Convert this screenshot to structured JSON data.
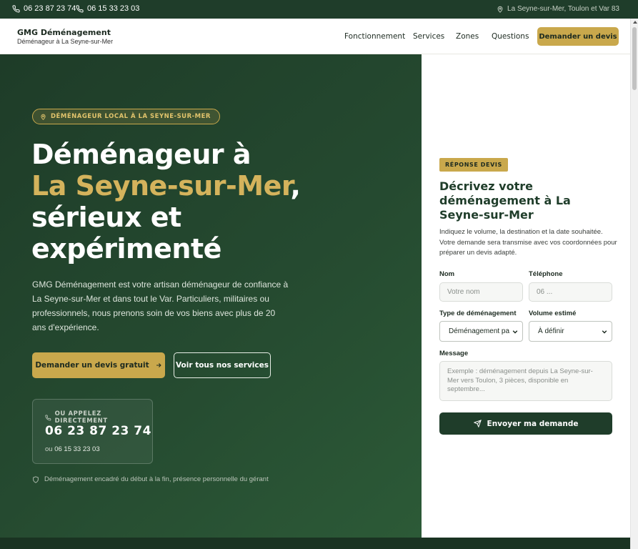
{
  "topbar": {
    "phone1": "06 23 87 23 74",
    "phone2": "06 15 33 23 03",
    "location": "La Seyne-sur-Mer, Toulon et Var 83"
  },
  "header": {
    "brand_title": "GMG Déménagement",
    "brand_subtitle": "Déménageur à La Seyne-sur-Mer",
    "nav": [
      "Fonctionnement",
      "Services",
      "Zones",
      "Questions"
    ],
    "cta": "Demander un devis"
  },
  "hero": {
    "badge": "DÉMÉNAGEUR LOCAL À LA SEYNE-SUR-MER",
    "title_line1": "Déménageur à",
    "title_highlight": "La Seyne-sur-Mer",
    "title_comma": ",",
    "title_line3": "sérieux et",
    "title_line4": "expérimenté",
    "description": "GMG Déménagement est votre artisan déménageur de confiance à La Seyne-sur-Mer et dans tout le Var. Particuliers, militaires ou professionnels, nous prenons soin de vos biens avec plus de 20 ans d'expérience.",
    "primary_button": "Demander un devis gratuit",
    "secondary_button": "Voir tous nos services",
    "call_label": "OU APPELEZ DIRECTEMENT",
    "call_main": "06 23 87 23 74",
    "call_alt_prefix": "ou",
    "call_alt_number": "06 15 33 23 03",
    "reassurance": "Déménagement encadré du début à la fin, présence personnelle du gérant"
  },
  "form": {
    "badge": "RÉPONSE DEVIS",
    "title": "Décrivez votre déménagement à La Seyne-sur-Mer",
    "description": "Indiquez le volume, la destination et la date souhaitée. Votre demande sera transmise avec vos coordonnées pour préparer un devis adapté.",
    "name_label": "Nom",
    "name_placeholder": "Votre nom",
    "phone_label": "Téléphone",
    "phone_placeholder": "06 ...",
    "type_label": "Type de déménagement",
    "type_value": "Déménagement pa",
    "volume_label": "Volume estimé",
    "volume_value": "À définir",
    "message_label": "Message",
    "message_placeholder": "Exemple : déménagement depuis La Seyne-sur-Mer vers Toulon, 3 pièces, disponible en septembre...",
    "submit": "Envoyer ma demande"
  },
  "colors": {
    "dark_green": "#1f3d2a",
    "gold": "#c9a84c"
  }
}
